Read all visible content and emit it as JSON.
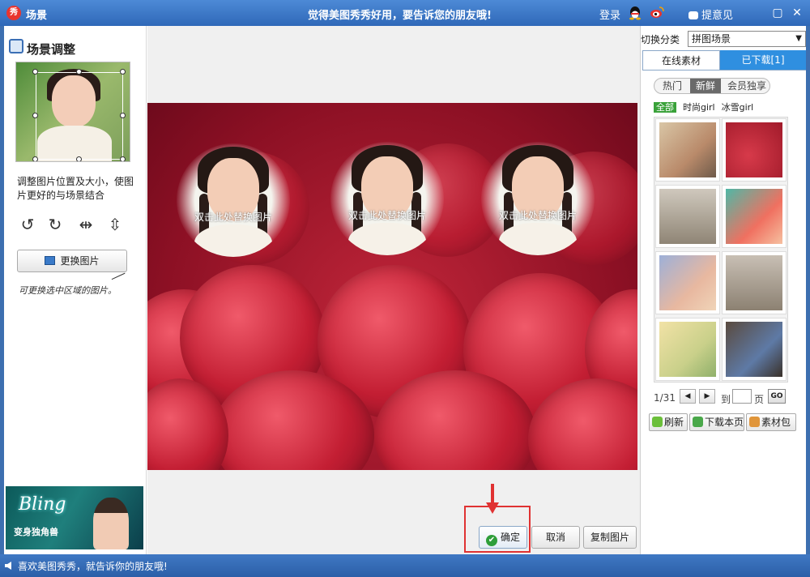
{
  "window": {
    "title": "场景",
    "slogan": "觉得美图秀秀好用，要告诉您的朋友哦!",
    "login": "登录",
    "feedback": "提意见"
  },
  "left": {
    "section_title": "场景调整",
    "description": "调整图片位置及大小，使图片更好的与场景结合",
    "replace_button": "更换图片",
    "hint": "可更换选中区域的图片。",
    "banner_title": "Bling",
    "banner_sub": "变身独角兽"
  },
  "canvas": {
    "placeholder_caption": "双击此处替换图片",
    "confirm": "确定",
    "cancel": "取消",
    "copy": "复制图片"
  },
  "right": {
    "category_label": "切换分类",
    "category_value": "拼图场景",
    "tabs": [
      "在线素材",
      "已下载[1]"
    ],
    "filters": [
      "热门",
      "新鲜",
      "会员独享"
    ],
    "active_filter": "新鲜",
    "subfilters": [
      "全部",
      "时尚girl",
      "冰雪girl"
    ],
    "pager": {
      "current": "1/31",
      "to_label": "到",
      "page_label": "页",
      "go": "GO"
    },
    "actions": [
      "刷新",
      "下载本页",
      "素材包"
    ]
  },
  "status": {
    "text": "喜欢美图秀秀，就告诉你的朋友哦!"
  },
  "colors": {
    "title_bar": "#2f68b8",
    "accent_tab": "#2f8fe0",
    "highlight_box": "#e03232",
    "confirm_check": "#2e9e3a"
  }
}
